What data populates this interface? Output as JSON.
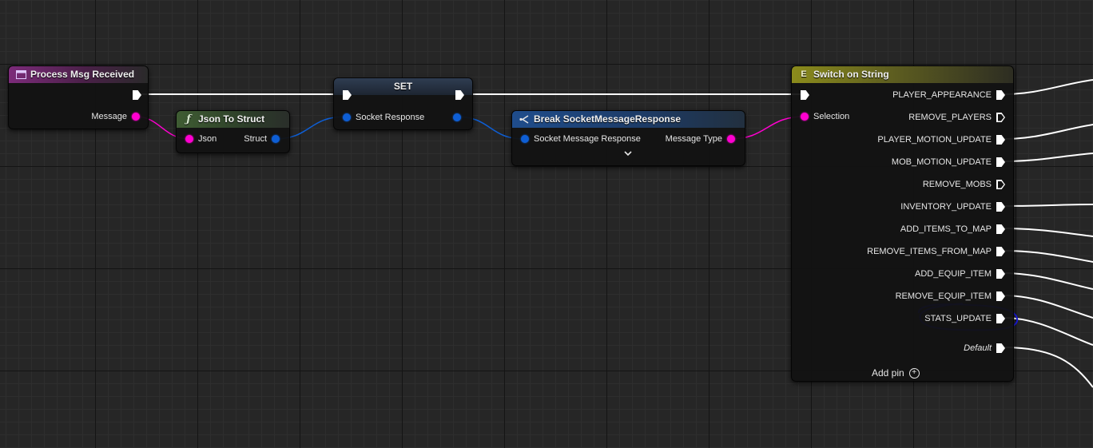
{
  "nodes": {
    "event": {
      "title": "Process Msg Received",
      "icon": "event-icon",
      "pin_message": "Message"
    },
    "json_to_struct": {
      "title": "Json To Struct",
      "icon": "function-icon",
      "pin_json": "Json",
      "pin_struct": "Struct"
    },
    "set": {
      "title": "SET",
      "pin_socket_response": "Socket Response"
    },
    "break": {
      "title": "Break SocketMessageResponse",
      "icon": "break-struct-icon",
      "pin_in": "Socket Message Response",
      "pin_out": "Message Type",
      "expand": "⌄"
    },
    "switch": {
      "title": "Switch on String",
      "icon": "switch-icon",
      "pin_selection": "Selection",
      "cases": [
        "PLAYER_APPEARANCE",
        "REMOVE_PLAYERS",
        "PLAYER_MOTION_UPDATE",
        "MOB_MOTION_UPDATE",
        "REMOVE_MOBS",
        "INVENTORY_UPDATE",
        "ADD_ITEMS_TO_MAP",
        "REMOVE_ITEMS_FROM_MAP",
        "ADD_EQUIP_ITEM",
        "REMOVE_EQUIP_ITEM",
        "STATS_UPDATE"
      ],
      "connected": [
        true,
        false,
        true,
        true,
        false,
        true,
        true,
        true,
        true,
        true,
        true
      ],
      "default_label": "Default",
      "add_pin_label": "Add pin"
    }
  },
  "colors": {
    "exec_wire": "#ffffff",
    "string_wire": "#ff00d0",
    "struct_wire": "#0e5ed4",
    "annotation": "#1a1adc"
  }
}
